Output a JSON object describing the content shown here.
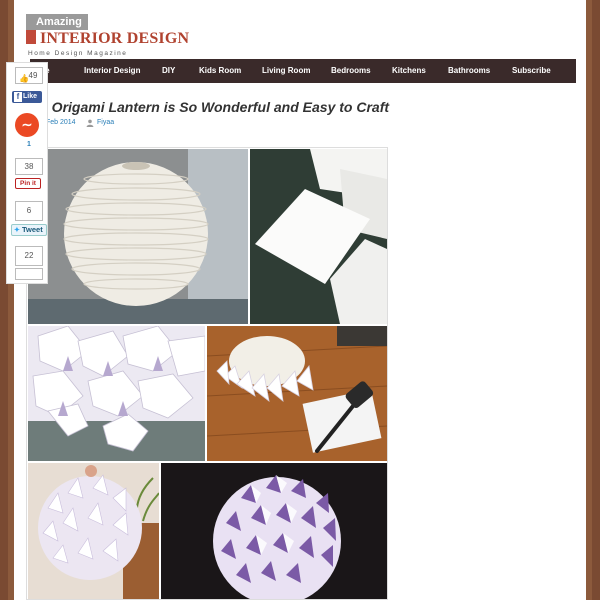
{
  "logo": {
    "amazing": "Amazing",
    "interior": "INTERIOR DESIGN",
    "tagline": "Home Design Magazine"
  },
  "nav": {
    "items": [
      {
        "label": "me"
      },
      {
        "label": "Interior Design"
      },
      {
        "label": "DIY"
      },
      {
        "label": "Kids Room"
      },
      {
        "label": "Living Room"
      },
      {
        "label": "Bedrooms"
      },
      {
        "label": "Kitchens"
      },
      {
        "label": "Bathrooms"
      },
      {
        "label": "Subscribe"
      }
    ]
  },
  "post": {
    "title": "s Origami Lantern is So Wonderful and Easy to Craft",
    "date": "Feb 2014",
    "author": "Fiyaa"
  },
  "share": {
    "fb_count": "49",
    "fb_like": "Like",
    "stumble_count": "1",
    "pin_count": "38",
    "pin_label": "Pin it",
    "tweet_count": "6",
    "tweet_label": "Tweet",
    "extra_count": "22"
  },
  "colors": {
    "background": "#7a4a32",
    "nav": "#3a2a2a",
    "brand_red": "#b0422f",
    "link_blue": "#2a7fb8"
  }
}
